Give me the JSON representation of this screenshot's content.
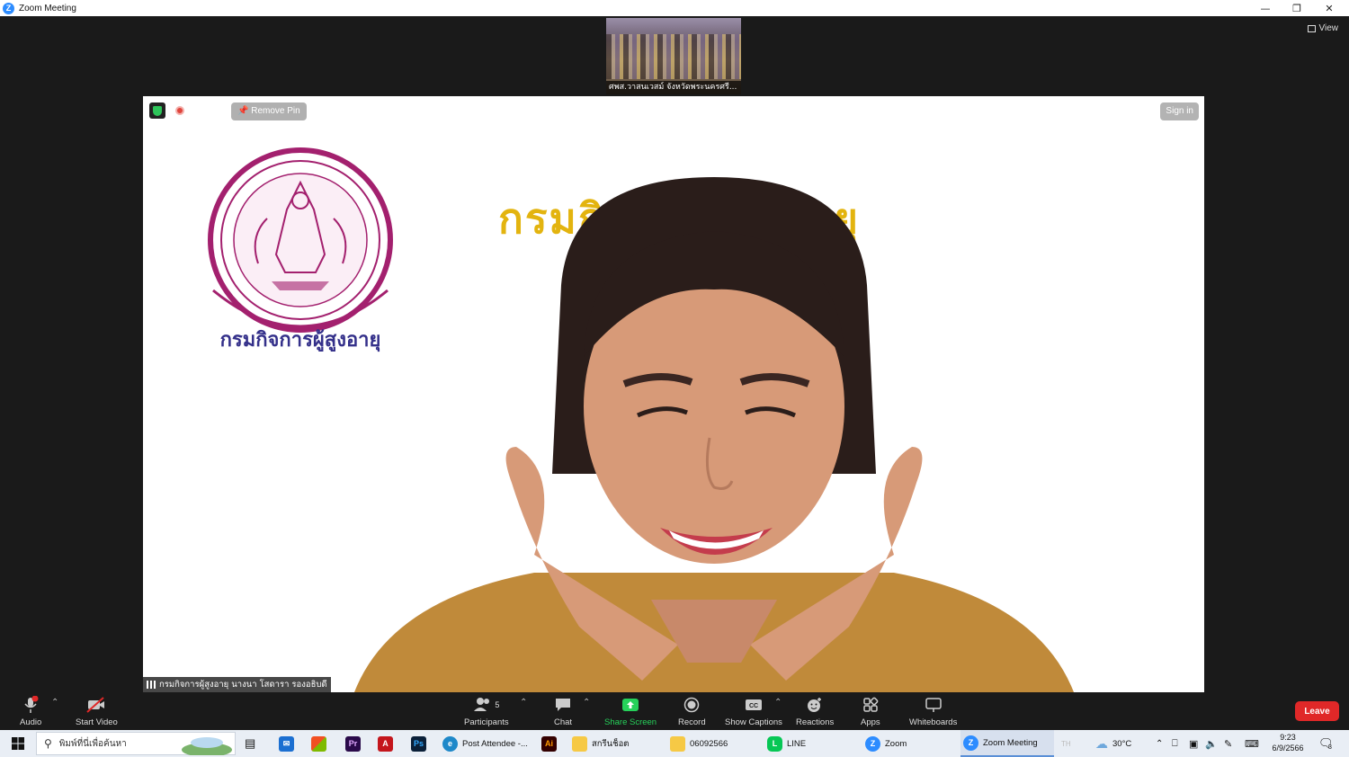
{
  "window": {
    "title": "Zoom Meeting"
  },
  "gallery": {
    "thumb_name": "ศพส.วาสนเวสม์ จังหวัดพระนครศรี...",
    "view_label": "View"
  },
  "speaker": {
    "remove_pin_label": "Remove Pin",
    "sign_in_label": "Sign in",
    "banner_text": "กรมกิจการผู้สูงอายุ",
    "seal_text": "กรมกิจการผู้สูงอายุ",
    "name_label": "กรมกิจการผู้สูงอายุ นางนา โสดารา รองอธิบดี"
  },
  "toolbar": {
    "audio": "Audio",
    "start_video": "Start Video",
    "participants": "Participants",
    "participants_count": "5",
    "chat": "Chat",
    "share_screen": "Share Screen",
    "record": "Record",
    "show_captions": "Show Captions",
    "reactions": "Reactions",
    "apps": "Apps",
    "whiteboards": "Whiteboards",
    "leave": "Leave",
    "share_color": "#26d15a",
    "leave_color": "#e02828"
  },
  "taskbar": {
    "search_placeholder": "พิมพ์ที่นี่เพื่อค้นหา",
    "items": [
      {
        "label": "Post Attendee -...",
        "icon": "edge-icon"
      },
      {
        "label": "สกรีนช็อต",
        "icon": "folder-icon"
      },
      {
        "label": "06092566",
        "icon": "folder-icon"
      },
      {
        "label": "LINE",
        "icon": "line-icon"
      },
      {
        "label": "Zoom",
        "icon": "zoom-icon"
      },
      {
        "label": "Zoom Meeting",
        "icon": "zoom-icon"
      }
    ],
    "temperature": "30°C",
    "time": "9:23",
    "date": "6/9/2566",
    "notif_count": "3",
    "lang": "TH"
  }
}
